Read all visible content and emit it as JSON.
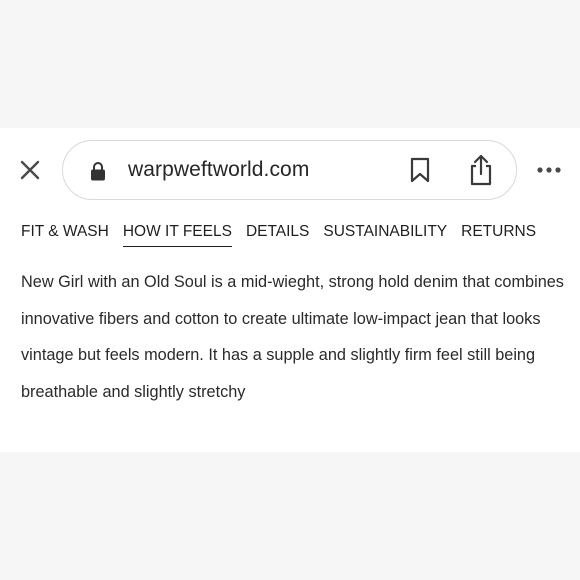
{
  "browser": {
    "url": "warpweftworld.com",
    "icons": {
      "close": "close-icon",
      "lock": "lock-icon",
      "bookmark": "bookmark-icon",
      "share": "share-icon",
      "more": "more-icon"
    }
  },
  "tabs": [
    {
      "label": "FIT & WASH",
      "active": false
    },
    {
      "label": "HOW IT FEELS",
      "active": true
    },
    {
      "label": "DETAILS",
      "active": false
    },
    {
      "label": "SUSTAINABILITY",
      "active": false
    },
    {
      "label": "RETURNS",
      "active": false
    }
  ],
  "content": {
    "paragraph": "New Girl with an Old Soul is a mid-wieght, strong hold denim that combines innovative fibers and cotton to create ultimate low-impact jean that looks vintage but feels modern. It has a supple and slightly firm feel still being breathable and slightly stretchy"
  },
  "colors": {
    "text": "#1f1f1f",
    "backdrop": "#f6f6f6",
    "url_border": "#d9d9d9"
  }
}
